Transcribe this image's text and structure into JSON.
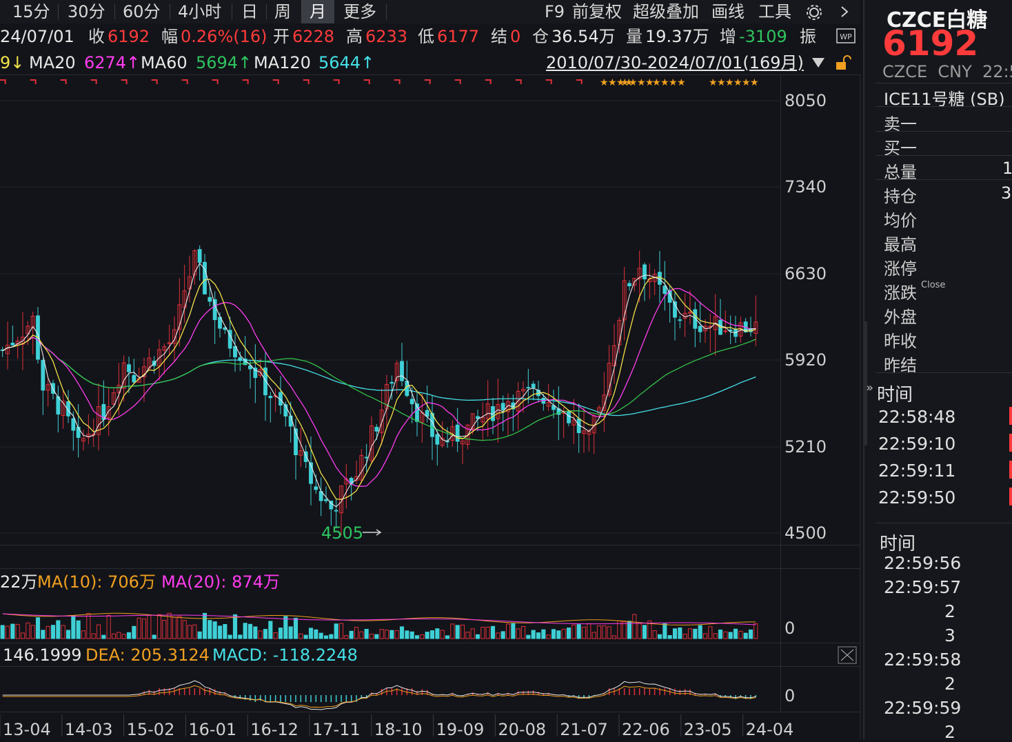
{
  "toolbar": {
    "periods": [
      "15分",
      "30分",
      "60分",
      "4小时",
      "日",
      "周",
      "月",
      "更多"
    ],
    "active_period": "月",
    "tools": [
      "F9",
      "前复权",
      "超级叠加",
      "画线",
      "工具"
    ]
  },
  "info": {
    "date": "24/07/01",
    "close_label": "收",
    "close": "6192",
    "change_label": "幅",
    "change": "0.26%(16)",
    "open_label": "开",
    "open": "6228",
    "high_label": "高",
    "high": "6233",
    "low_label": "低",
    "low": "6177",
    "settle_label": "结",
    "settle": "0",
    "oi_label": "仓",
    "oi": "36.54万",
    "vol_label": "量",
    "vol": "19.37万",
    "inc_label": "增",
    "inc": "-3109",
    "amp_label": "振"
  },
  "ma_row": {
    "ma10_tail": "9↓",
    "ma20_label": "MA20",
    "ma20": "6274↑",
    "ma60_label": "MA60",
    "ma60": "5694↑",
    "ma120_label": "MA120",
    "ma120": "5644↑",
    "range": "2010/07/30-2024/07/01(169月)"
  },
  "price_axis": [
    "8050",
    "7340",
    "6630",
    "5920",
    "5210",
    "4500"
  ],
  "low_marker": "4505",
  "volume": {
    "head": "22万",
    "ma10_label": "MA(10): 706万",
    "ma20_label": "MA(20): 874万",
    "zero": "0"
  },
  "macd": {
    "dif": "146.1999",
    "dea_label": "DEA: 205.3124",
    "macd_label": "MACD: -118.2248",
    "zero": "0"
  },
  "time_axis": [
    "13-04",
    "14-03",
    "15-02",
    "16-01",
    "16-12",
    "17-11",
    "18-10",
    "19-09",
    "20-08",
    "21-07",
    "22-06",
    "23-05",
    "24-04"
  ],
  "colors": {
    "up": "#e0303a",
    "down": "#3fd0d6",
    "ma5": "#e8e8e8",
    "ma10": "#f3e24a",
    "ma20": "#ff3cf0",
    "ma60": "#34c24a",
    "ma120": "#45e0e8"
  },
  "right_panel": {
    "title": "CZCE白糖",
    "price": "6192",
    "sub": "CZCE  CNY  22:5",
    "related": "ICE11号糖 (SB)",
    "fields": [
      "卖一",
      "买一",
      "总量",
      "持仓",
      "均价",
      "最高",
      "涨停",
      "涨跌",
      "外盘",
      "昨收",
      "昨结"
    ],
    "total_val": "1",
    "oi_val": "3",
    "close_note": "Close",
    "time_header": "时间",
    "times": [
      "22:58:48",
      "22:59:10",
      "22:59:11",
      "22:59:50"
    ],
    "time_header2": "时间",
    "ticks": [
      "22:59:56",
      "22:59:57",
      "2",
      "3",
      "22:59:58",
      "2",
      "22:59:59",
      "2"
    ]
  }
}
